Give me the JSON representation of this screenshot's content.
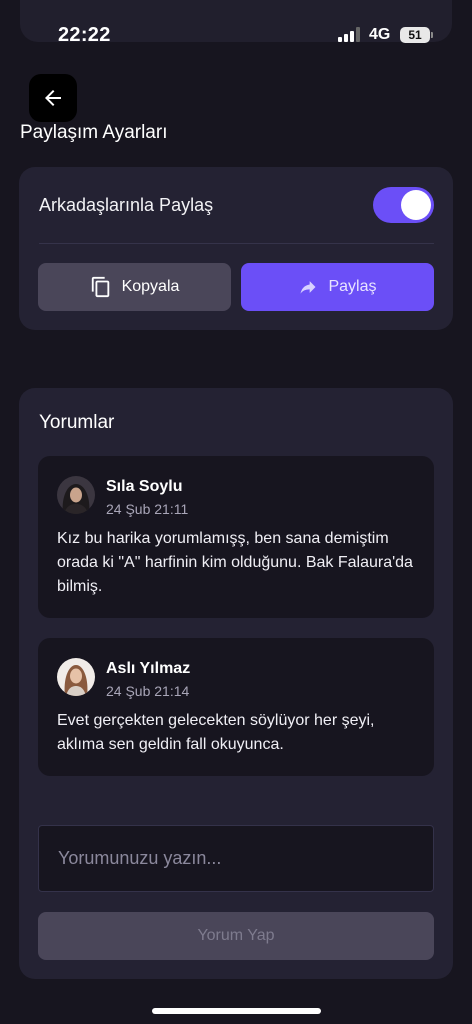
{
  "status": {
    "time": "22:22",
    "network": "4G",
    "battery": "51"
  },
  "header": {
    "title": "Paylaşım Ayarları"
  },
  "share": {
    "toggle_label": "Arkadaşlarınla Paylaş",
    "toggle_on": true,
    "copy_label": "Kopyala",
    "share_label": "Paylaş"
  },
  "comments": {
    "title": "Yorumlar",
    "items": [
      {
        "author": "Sıla Soylu",
        "date": "24 Şub 21:11",
        "text": "Kız bu harika yorumlamışş, ben sana demiştim orada ki \"A\" harfinin kim olduğunu. Bak Falaura'da bilmiş."
      },
      {
        "author": "Aslı Yılmaz",
        "date": "24 Şub 21:14",
        "text": "Evet gerçekten gelecekten söylüyor her şeyi, aklıma sen geldin fall okuyunca."
      }
    ],
    "input_placeholder": "Yorumunuzu yazın...",
    "submit_label": "Yorum Yap"
  },
  "colors": {
    "background": "#17151f",
    "card": "#242233",
    "accent": "#6b4ff7",
    "muted_button": "#4a4659"
  },
  "icons": {
    "back": "arrow-left-icon",
    "copy": "copy-icon",
    "share": "share-arrow-icon"
  }
}
